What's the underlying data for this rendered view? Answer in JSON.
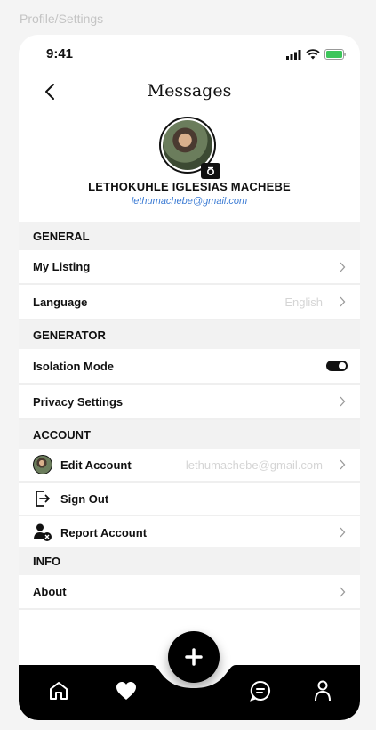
{
  "frame_label": "Profile/Settings",
  "status": {
    "time": "9:41"
  },
  "header": {
    "title": "Messages"
  },
  "profile": {
    "name": "LETHOKUHLE IGLESIAS MACHEBE",
    "email": "lethumachebe@gmail.com"
  },
  "sections": {
    "general": {
      "title": "GENERAL",
      "items": [
        {
          "label": "My Listing"
        },
        {
          "label": "Language",
          "value": "English"
        }
      ]
    },
    "generator": {
      "title": "GENERATOR",
      "items": [
        {
          "label": "Isolation Mode",
          "toggle": true
        },
        {
          "label": "Privacy Settings"
        }
      ]
    },
    "account": {
      "title": "ACCOUNT",
      "items": [
        {
          "label": "Edit Account",
          "value": "lethumachebe@gmail.com",
          "icon": "avatar"
        },
        {
          "label": "Sign Out",
          "icon": "sign-out-icon"
        },
        {
          "label": "Report Account",
          "icon": "report-user-icon"
        }
      ]
    },
    "info": {
      "title": "INFO",
      "items": [
        {
          "label": "About"
        }
      ]
    }
  },
  "bottom_nav": {
    "items": [
      "home-icon",
      "heart-icon",
      "add-icon",
      "chat-icon",
      "profile-icon"
    ]
  },
  "colors": {
    "email_link": "#3b7bd4",
    "battery": "#3cc55a",
    "nav_bg": "#000000"
  }
}
